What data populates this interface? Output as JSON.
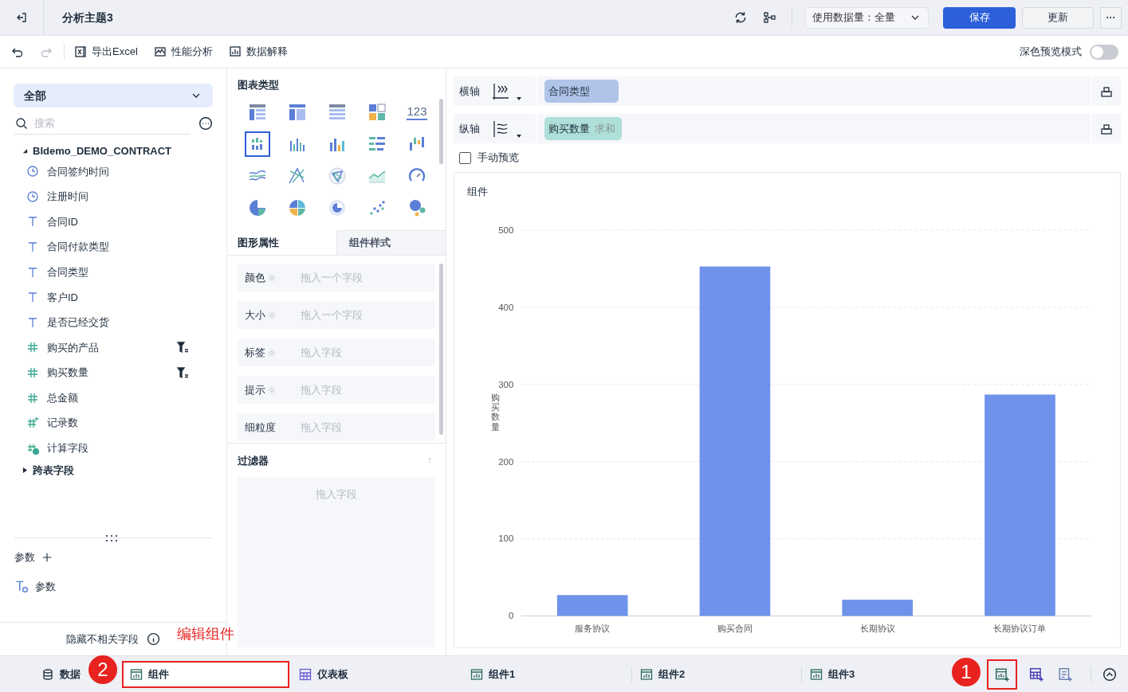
{
  "header": {
    "title": "分析主题3",
    "data_amount": "使用数据量：全量",
    "save": "保存",
    "update": "更新",
    "more": "···"
  },
  "toolbar": {
    "items": [
      {
        "kind": "excel",
        "label": "导出Excel"
      },
      {
        "kind": "perf",
        "label": "性能分析"
      },
      {
        "kind": "explain",
        "label": "数据解释"
      }
    ],
    "dark_mode": {
      "label": "深色预览模式",
      "on": false
    }
  },
  "data_panel": {
    "scope": "全部",
    "search": {
      "placeholder": "搜索"
    },
    "table": {
      "name": "BIdemo_DEMO_CONTRACT",
      "expanded": true
    },
    "fields": [
      {
        "kind": "time",
        "name": "合同签约时间",
        "filtered": false
      },
      {
        "kind": "time",
        "name": "注册时间",
        "filtered": false
      },
      {
        "kind": "text",
        "name": "合同ID",
        "filtered": false
      },
      {
        "kind": "text",
        "name": "合同付款类型",
        "filtered": false
      },
      {
        "kind": "text",
        "name": "合同类型",
        "filtered": false
      },
      {
        "kind": "text",
        "name": "客户ID",
        "filtered": false
      },
      {
        "kind": "text",
        "name": "是否已经交货",
        "filtered": false
      },
      {
        "kind": "number",
        "name": "购买的产品",
        "filtered": true
      },
      {
        "kind": "number",
        "name": "购买数量",
        "filtered": true
      },
      {
        "kind": "number",
        "name": "总金额",
        "filtered": false
      },
      {
        "kind": "count",
        "name": "记录数",
        "filtered": false
      },
      {
        "kind": "calc",
        "name": "计算字段",
        "filtered": false
      }
    ],
    "cross_table": {
      "name": "跨表字段",
      "expanded": false
    },
    "params": {
      "title": "参数",
      "items": [
        "参数"
      ]
    },
    "hide_unrelated": "隐藏不相关字段"
  },
  "chart_panel": {
    "title": "图表类型",
    "types": [
      {
        "selected": false
      },
      {
        "selected": false
      },
      {
        "selected": false
      },
      {
        "selected": false
      },
      {
        "selected": false,
        "label": "123"
      },
      {
        "selected": true
      },
      {
        "selected": false
      },
      {
        "selected": false
      },
      {
        "selected": false
      },
      {
        "selected": false
      },
      {
        "selected": false
      },
      {
        "selected": false
      },
      {
        "selected": false
      },
      {
        "selected": false
      },
      {
        "selected": false
      },
      {
        "selected": false
      },
      {
        "selected": false
      },
      {
        "selected": false
      },
      {
        "selected": false
      },
      {
        "selected": false
      }
    ],
    "tabs": [
      {
        "label": "图形属性",
        "selected": true
      },
      {
        "label": "组件样式",
        "selected": false
      }
    ],
    "properties": [
      {
        "label": "颜色",
        "settings": true,
        "placeholder": "拖入一个字段"
      },
      {
        "label": "大小",
        "settings": true,
        "placeholder": "拖入一个字段"
      },
      {
        "label": "标签",
        "settings": true,
        "placeholder": "拖入字段"
      },
      {
        "label": "提示",
        "settings": true,
        "placeholder": "拖入字段"
      },
      {
        "label": "细粒度",
        "settings": false,
        "placeholder": "拖入字段"
      }
    ],
    "filter": {
      "title": "过滤器",
      "placeholder": "拖入字段"
    }
  },
  "axes": [
    {
      "label": "横轴",
      "kind": "x",
      "field": "合同类型",
      "color": "#b0c4e8"
    },
    {
      "label": "纵轴",
      "kind": "y",
      "field": "购买数量",
      "agg": "求和",
      "color": "#aee0d9"
    }
  ],
  "manual_preview": {
    "label": "手动预览",
    "checked": false
  },
  "widget": {
    "title": "组件",
    "chart_data": {
      "type": "bar",
      "ylabel": "购买数量",
      "categories": [
        "服务协议",
        "购买合同",
        "长期协议",
        "长期协议订单"
      ],
      "series": [
        {
          "color": "#6f93eb",
          "values": [
            27,
            453,
            21,
            287
          ]
        }
      ],
      "grid": true,
      "ylim": [
        0,
        500
      ],
      "yticks": [
        0,
        100,
        200,
        300,
        400,
        500
      ]
    }
  },
  "bottom_tabs": [
    {
      "kind": "data",
      "label": "数据",
      "selected": false
    },
    {
      "kind": "widget",
      "label": "组件",
      "selected": true
    },
    {
      "kind": "dashboard",
      "label": "仪表板",
      "selected": false
    },
    {
      "kind": "widget",
      "label": "组件1",
      "selected": false
    },
    {
      "kind": "widget",
      "label": "组件2",
      "selected": false
    },
    {
      "kind": "widget",
      "label": "组件3",
      "selected": false
    }
  ],
  "annotations": {
    "note": "编辑组件",
    "step_one": "1",
    "step_two": "2"
  }
}
